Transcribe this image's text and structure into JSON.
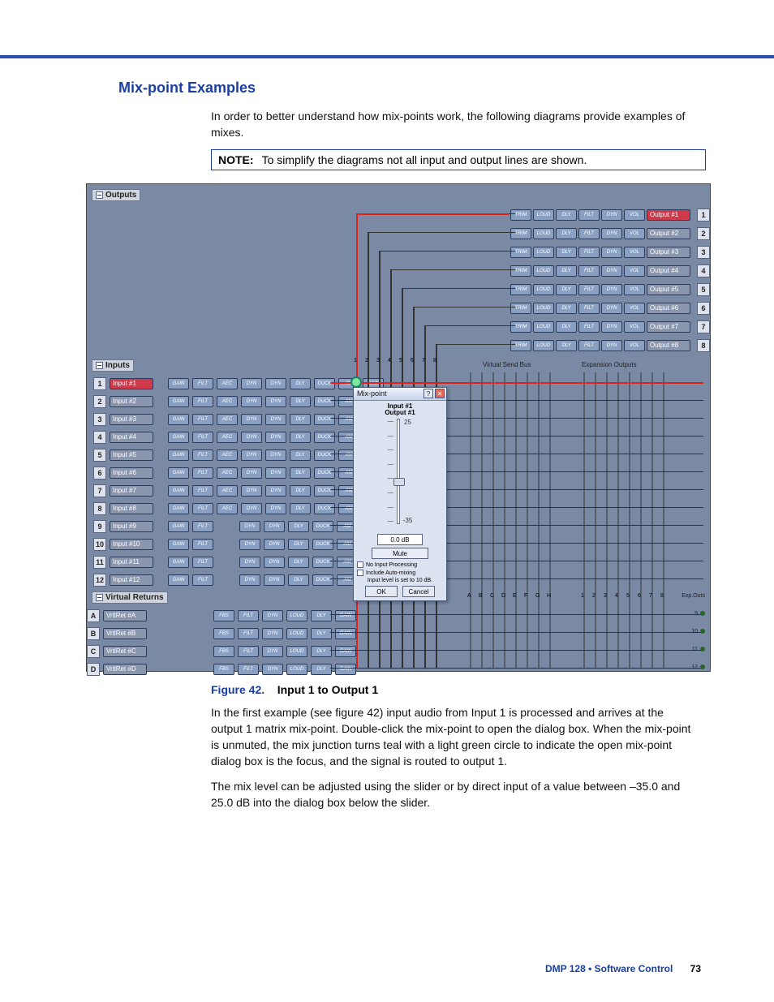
{
  "section_title": "Mix-point Examples",
  "intro": "In order to better understand how mix-points work, the following diagrams provide examples of mixes.",
  "note": {
    "label": "NOTE:",
    "text": "To simplify the diagrams not all input and output lines are shown."
  },
  "figure": {
    "caption_label": "Figure 42.",
    "caption_title": "Input 1 to Output 1",
    "outputs_header": "Outputs",
    "inputs_header": "Inputs",
    "vr_header": "Virtual Returns",
    "output_proc": [
      "TRIM",
      "LOUD",
      "DLY",
      "FILT",
      "DYN",
      "VOL"
    ],
    "outputs": [
      {
        "num": "1",
        "label": "Output #1",
        "highlight": true
      },
      {
        "num": "2",
        "label": "Output #2"
      },
      {
        "num": "3",
        "label": "Output #3"
      },
      {
        "num": "4",
        "label": "Output #4"
      },
      {
        "num": "5",
        "label": "Output #5"
      },
      {
        "num": "6",
        "label": "Output #6"
      },
      {
        "num": "7",
        "label": "Output #7"
      },
      {
        "num": "8",
        "label": "Output #8"
      }
    ],
    "input_proc_full": [
      "GAIN",
      "FILT",
      "AEC",
      "DYN",
      "DYN",
      "DLY",
      "DUCK",
      "AM",
      "GAIN"
    ],
    "input_proc_short": [
      "GAIN",
      "FILT",
      "",
      "DYN",
      "DYN",
      "DLY",
      "DUCK",
      "AM",
      "GAIN"
    ],
    "inputs": [
      {
        "num": "1",
        "label": "Input #1",
        "highlight": true,
        "proc": "full"
      },
      {
        "num": "2",
        "label": "Input #2",
        "proc": "full"
      },
      {
        "num": "3",
        "label": "Input #3",
        "proc": "full"
      },
      {
        "num": "4",
        "label": "Input #4",
        "proc": "full"
      },
      {
        "num": "5",
        "label": "Input #5",
        "proc": "full"
      },
      {
        "num": "6",
        "label": "Input #6",
        "proc": "full"
      },
      {
        "num": "7",
        "label": "Input #7",
        "proc": "full"
      },
      {
        "num": "8",
        "label": "Input #8",
        "proc": "full"
      },
      {
        "num": "9",
        "label": "Input #9",
        "proc": "short"
      },
      {
        "num": "10",
        "label": "Input #10",
        "proc": "short"
      },
      {
        "num": "11",
        "label": "Input #11",
        "proc": "short"
      },
      {
        "num": "12",
        "label": "Input #12",
        "proc": "short"
      }
    ],
    "vr_proc": [
      "FBS",
      "FILT",
      "DYN",
      "LOUD",
      "DLY",
      "GAIN"
    ],
    "vreturns": [
      {
        "letter": "A",
        "label": "VrtlRet #A"
      },
      {
        "letter": "B",
        "label": "VrtlRet #B"
      },
      {
        "letter": "C",
        "label": "VrtlRet #C"
      },
      {
        "letter": "D",
        "label": "VrtlRet #D"
      }
    ],
    "col_labels_main": [
      "1",
      "2",
      "3",
      "4",
      "5",
      "6",
      "7",
      "8"
    ],
    "vsb_label": "Virtual Send Bus",
    "vsb_cols": [
      "A",
      "B",
      "C",
      "D",
      "E",
      "F",
      "G",
      "H"
    ],
    "exp_header": "Expansion Outputs",
    "exp_cols": [
      "1",
      "2",
      "3",
      "4",
      "5",
      "6",
      "7",
      "8"
    ],
    "exp_outs_label": "Exp.Outs",
    "exp_outs": [
      "9",
      "10",
      "11",
      "12"
    ],
    "dialog": {
      "title": "Mix-point",
      "input_line": "Input #1",
      "output_line": "Output #1",
      "max": "25",
      "min": "-35",
      "value": "0.0 dB",
      "mute": "Mute",
      "chk1": "No Input Processing",
      "chk2": "Include Auto-mixing",
      "status": "Input level is set to 10 dB.",
      "ok": "OK",
      "cancel": "Cancel"
    }
  },
  "para1": "In the first example (see figure 42) input audio from Input 1 is processed and arrives at the output 1 matrix mix-point. Double-click the mix-point to open the dialog box. When the mix-point is unmuted, the mix junction turns teal with a light green circle to indicate the open mix-point dialog box is the focus, and the signal is routed to output 1.",
  "para2": "The mix level can be adjusted using the slider or by direct input of a value between –35.0 and 25.0 dB into the dialog box below the slider.",
  "footer": {
    "text": "DMP 128 • Software Control",
    "page": "73"
  }
}
